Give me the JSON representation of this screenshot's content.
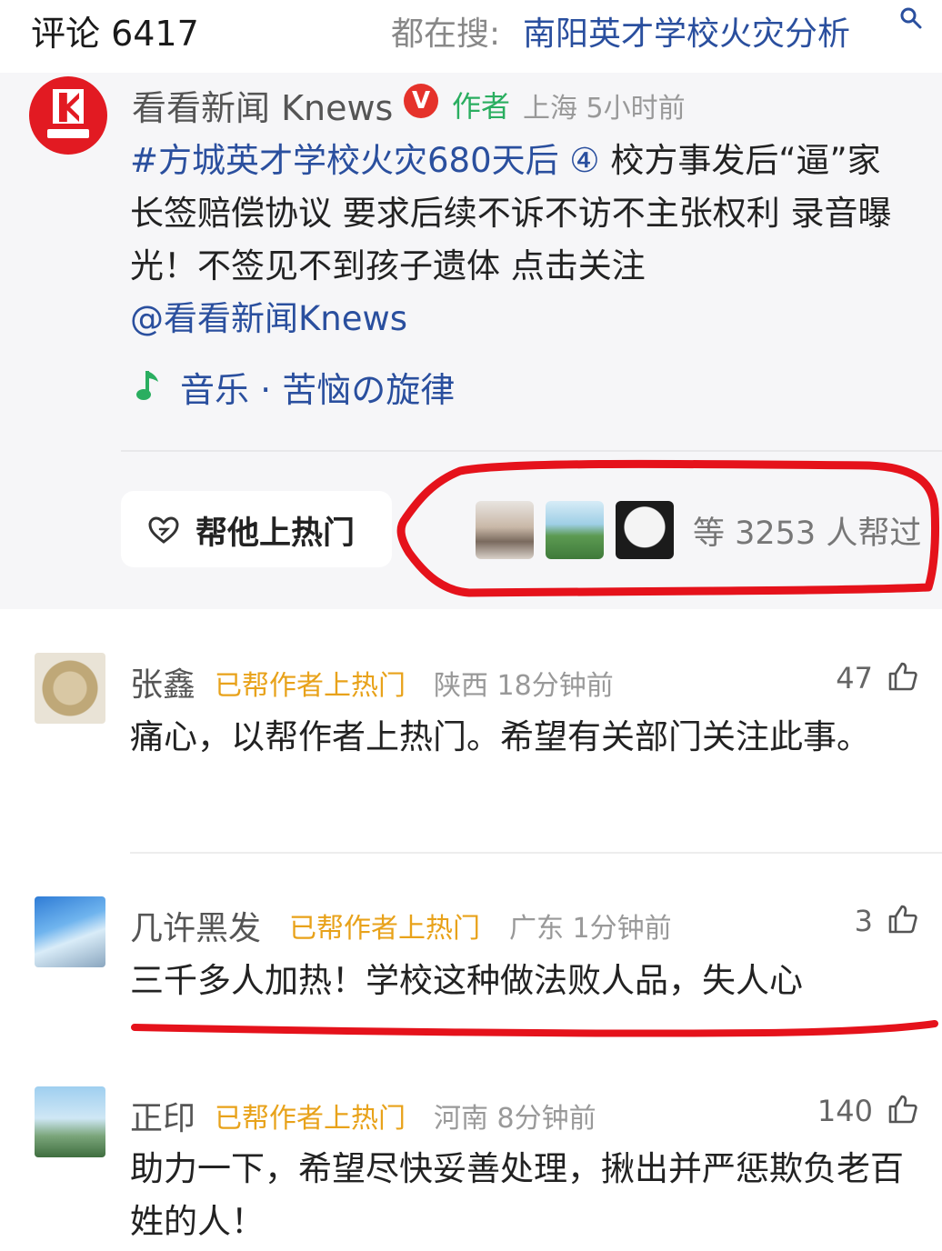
{
  "header": {
    "comment_count": "评论 6417",
    "search_prefix": "都在搜:",
    "search_query": "南阳英才学校火灾分析",
    "search_icon": "search-icon"
  },
  "post": {
    "author_name": "看看新闻 Knews",
    "verified_badge": "V",
    "author_role": "作者",
    "location_time": "上海 5小时前",
    "hashtag": "#方城英才学校火灾680天后 ④",
    "body_text": " 校方事发后“逼”家长签赔偿协议 要求后续不诉不访不主张权利 录音曝光！不签见不到孩子遗体 点击关注",
    "mention": "@看看新闻Knews",
    "music_label": "音乐 · 苦恼の旋律",
    "music_icon": "music-note-icon"
  },
  "boost": {
    "button_label": "帮他上热门",
    "button_icon": "heart-icon",
    "helpers_text": "等 3253 人帮过"
  },
  "comments": [
    {
      "name": "张鑫",
      "badge": "已帮作者上热门",
      "meta": "陕西 18分钟前",
      "likes": "47",
      "text": "痛心，以帮作者上热门。希望有关部门关注此事。"
    },
    {
      "name": "几许黑发",
      "badge": "已帮作者上热门",
      "meta": "广东 1分钟前",
      "likes": "3",
      "text": "三千多人加热！学校这种做法败人品，失人心"
    },
    {
      "name": "正印",
      "badge": "已帮作者上热门",
      "meta": "河南 8分钟前",
      "likes": "140",
      "text": "助力一下，希望尽快妥善处理，揪出并严惩欺负老百姓的人！"
    }
  ],
  "colors": {
    "link_blue": "#2a4f9e",
    "badge_gold": "#e8a21a",
    "author_green": "#2aae60",
    "annotation_red": "#e5121b"
  }
}
